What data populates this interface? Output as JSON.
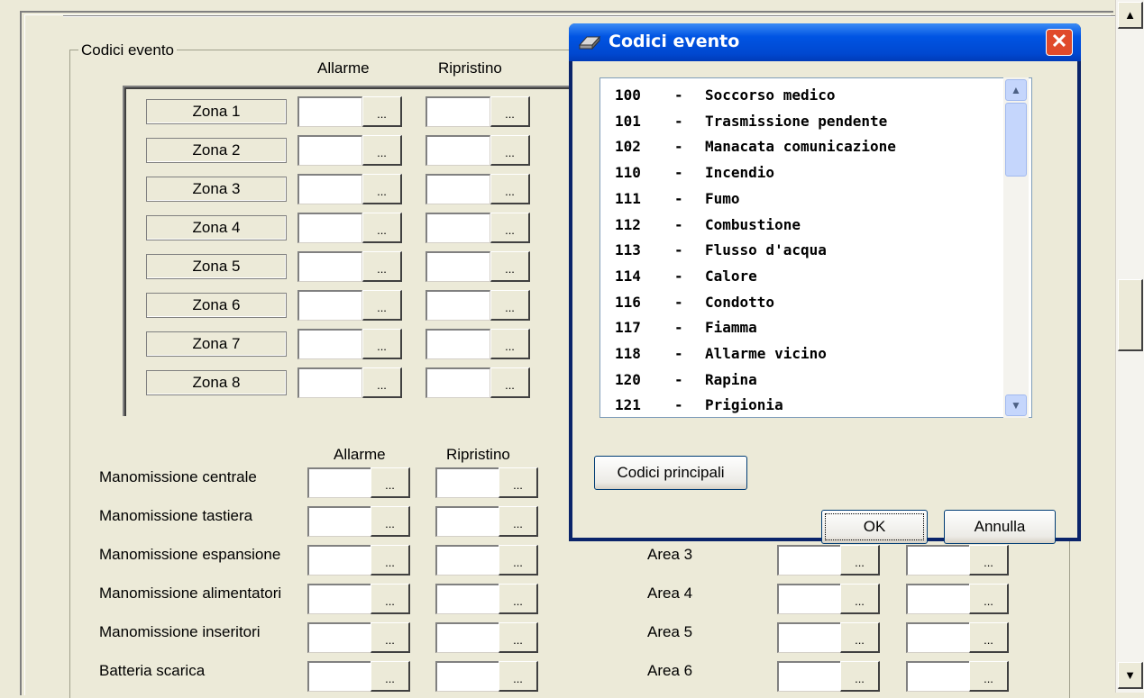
{
  "main": {
    "groupbox_title": "Codici evento",
    "col_allarme": "Allarme",
    "col_ripristino": "Ripristino",
    "zones": [
      "Zona 1",
      "Zona 2",
      "Zona 3",
      "Zona 4",
      "Zona 5",
      "Zona 6",
      "Zona 7",
      "Zona 8"
    ],
    "dots": "...",
    "tamper_rows": [
      "Manomissione centrale",
      "Manomissione tastiera",
      "Manomissione espansione",
      "Manomissione alimentatori",
      "Manomissione inseritori",
      "Batteria scarica"
    ],
    "area_rows": [
      "Area 3",
      "Area 4",
      "Area 5",
      "Area 6"
    ]
  },
  "dialog": {
    "title": "Codici evento",
    "codes": [
      {
        "num": "100",
        "desc": "Soccorso medico"
      },
      {
        "num": "101",
        "desc": "Trasmissione pendente"
      },
      {
        "num": "102",
        "desc": "Manacata comunicazione"
      },
      {
        "num": "110",
        "desc": "Incendio"
      },
      {
        "num": "111",
        "desc": "Fumo"
      },
      {
        "num": "112",
        "desc": "Combustione"
      },
      {
        "num": "113",
        "desc": "Flusso d'acqua"
      },
      {
        "num": "114",
        "desc": "Calore"
      },
      {
        "num": "116",
        "desc": "Condotto"
      },
      {
        "num": "117",
        "desc": "Fiamma"
      },
      {
        "num": "118",
        "desc": "Allarme vicino"
      },
      {
        "num": "120",
        "desc": "Rapina"
      },
      {
        "num": "121",
        "desc": "Prigionia"
      }
    ],
    "dash": "-",
    "btn_main_codes": "Codici principali",
    "btn_ok": "OK",
    "btn_cancel": "Annulla"
  },
  "icons": {
    "close": "close-icon",
    "scroll_up": "scroll-up-icon",
    "scroll_down": "scroll-down-icon"
  }
}
